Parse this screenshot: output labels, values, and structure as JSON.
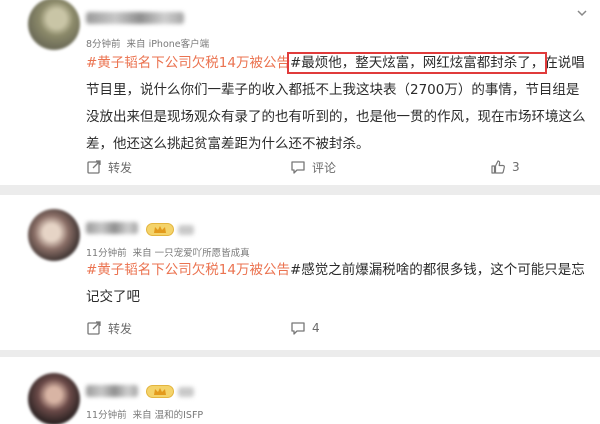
{
  "posts": [
    {
      "time": "8分钟前",
      "source": "来自 iPhone客户端",
      "hashtag": "#黄子韬名下公司欠税14万被公告",
      "highlight": "#最烦他，整天炫富，网红炫富都封杀了，",
      "rest": "在说唱节目里，说什么你们一辈子的收入都抵不上我这块表（2700万）的事情，节目组是没放出来但是现场观众有录了的也有听到的，也是他一贯的作风，现在市场环境这么差，他还这么挑起贫富差距为什么还不被封杀。",
      "repost_label": "转发",
      "comment_label": "评论",
      "like_count": "3"
    },
    {
      "time": "11分钟前",
      "source": "来自 一只宠爱吖所愿皆成真",
      "hashtag": "#黄子韬名下公司欠税14万被公告",
      "rest": "#感觉之前爆漏税啥的都很多钱，这个可能只是忘记交了吧",
      "repost_label": "转发",
      "comment_count": "4"
    },
    {
      "time": "11分钟前",
      "source": "来自 温和的ISFP"
    }
  ],
  "colors": {
    "hashtag": "#eb7350",
    "highlight_box": "#e03b3b",
    "crown": "#f4d36a"
  },
  "icons": [
    "chevron-down-icon",
    "repost-icon",
    "comment-icon",
    "like-icon",
    "crown-icon"
  ]
}
